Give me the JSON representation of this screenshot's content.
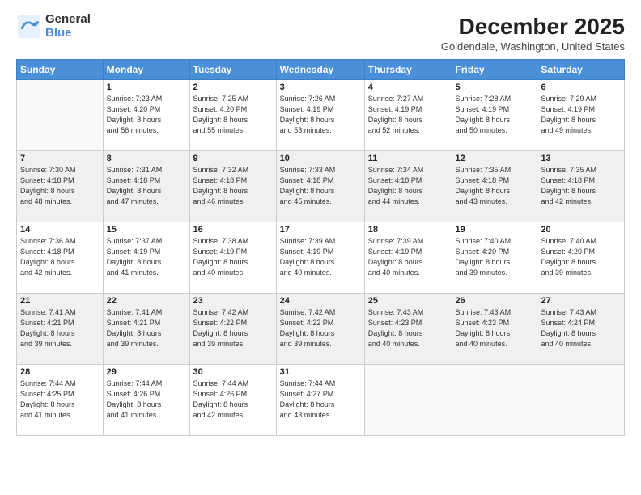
{
  "logo": {
    "line1": "General",
    "line2": "Blue"
  },
  "title": {
    "month_year": "December 2025",
    "location": "Goldendale, Washington, United States"
  },
  "days_of_week": [
    "Sunday",
    "Monday",
    "Tuesday",
    "Wednesday",
    "Thursday",
    "Friday",
    "Saturday"
  ],
  "weeks": [
    [
      {
        "num": "",
        "info": ""
      },
      {
        "num": "1",
        "info": "Sunrise: 7:23 AM\nSunset: 4:20 PM\nDaylight: 8 hours\nand 56 minutes."
      },
      {
        "num": "2",
        "info": "Sunrise: 7:25 AM\nSunset: 4:20 PM\nDaylight: 8 hours\nand 55 minutes."
      },
      {
        "num": "3",
        "info": "Sunrise: 7:26 AM\nSunset: 4:19 PM\nDaylight: 8 hours\nand 53 minutes."
      },
      {
        "num": "4",
        "info": "Sunrise: 7:27 AM\nSunset: 4:19 PM\nDaylight: 8 hours\nand 52 minutes."
      },
      {
        "num": "5",
        "info": "Sunrise: 7:28 AM\nSunset: 4:19 PM\nDaylight: 8 hours\nand 50 minutes."
      },
      {
        "num": "6",
        "info": "Sunrise: 7:29 AM\nSunset: 4:19 PM\nDaylight: 8 hours\nand 49 minutes."
      }
    ],
    [
      {
        "num": "7",
        "info": "Sunrise: 7:30 AM\nSunset: 4:18 PM\nDaylight: 8 hours\nand 48 minutes."
      },
      {
        "num": "8",
        "info": "Sunrise: 7:31 AM\nSunset: 4:18 PM\nDaylight: 8 hours\nand 47 minutes."
      },
      {
        "num": "9",
        "info": "Sunrise: 7:32 AM\nSunset: 4:18 PM\nDaylight: 8 hours\nand 46 minutes."
      },
      {
        "num": "10",
        "info": "Sunrise: 7:33 AM\nSunset: 4:18 PM\nDaylight: 8 hours\nand 45 minutes."
      },
      {
        "num": "11",
        "info": "Sunrise: 7:34 AM\nSunset: 4:18 PM\nDaylight: 8 hours\nand 44 minutes."
      },
      {
        "num": "12",
        "info": "Sunrise: 7:35 AM\nSunset: 4:18 PM\nDaylight: 8 hours\nand 43 minutes."
      },
      {
        "num": "13",
        "info": "Sunrise: 7:35 AM\nSunset: 4:18 PM\nDaylight: 8 hours\nand 42 minutes."
      }
    ],
    [
      {
        "num": "14",
        "info": "Sunrise: 7:36 AM\nSunset: 4:18 PM\nDaylight: 8 hours\nand 42 minutes."
      },
      {
        "num": "15",
        "info": "Sunrise: 7:37 AM\nSunset: 4:19 PM\nDaylight: 8 hours\nand 41 minutes."
      },
      {
        "num": "16",
        "info": "Sunrise: 7:38 AM\nSunset: 4:19 PM\nDaylight: 8 hours\nand 40 minutes."
      },
      {
        "num": "17",
        "info": "Sunrise: 7:39 AM\nSunset: 4:19 PM\nDaylight: 8 hours\nand 40 minutes."
      },
      {
        "num": "18",
        "info": "Sunrise: 7:39 AM\nSunset: 4:19 PM\nDaylight: 8 hours\nand 40 minutes."
      },
      {
        "num": "19",
        "info": "Sunrise: 7:40 AM\nSunset: 4:20 PM\nDaylight: 8 hours\nand 39 minutes."
      },
      {
        "num": "20",
        "info": "Sunrise: 7:40 AM\nSunset: 4:20 PM\nDaylight: 8 hours\nand 39 minutes."
      }
    ],
    [
      {
        "num": "21",
        "info": "Sunrise: 7:41 AM\nSunset: 4:21 PM\nDaylight: 8 hours\nand 39 minutes."
      },
      {
        "num": "22",
        "info": "Sunrise: 7:41 AM\nSunset: 4:21 PM\nDaylight: 8 hours\nand 39 minutes."
      },
      {
        "num": "23",
        "info": "Sunrise: 7:42 AM\nSunset: 4:22 PM\nDaylight: 8 hours\nand 39 minutes."
      },
      {
        "num": "24",
        "info": "Sunrise: 7:42 AM\nSunset: 4:22 PM\nDaylight: 8 hours\nand 39 minutes."
      },
      {
        "num": "25",
        "info": "Sunrise: 7:43 AM\nSunset: 4:23 PM\nDaylight: 8 hours\nand 40 minutes."
      },
      {
        "num": "26",
        "info": "Sunrise: 7:43 AM\nSunset: 4:23 PM\nDaylight: 8 hours\nand 40 minutes."
      },
      {
        "num": "27",
        "info": "Sunrise: 7:43 AM\nSunset: 4:24 PM\nDaylight: 8 hours\nand 40 minutes."
      }
    ],
    [
      {
        "num": "28",
        "info": "Sunrise: 7:44 AM\nSunset: 4:25 PM\nDaylight: 8 hours\nand 41 minutes."
      },
      {
        "num": "29",
        "info": "Sunrise: 7:44 AM\nSunset: 4:26 PM\nDaylight: 8 hours\nand 41 minutes."
      },
      {
        "num": "30",
        "info": "Sunrise: 7:44 AM\nSunset: 4:26 PM\nDaylight: 8 hours\nand 42 minutes."
      },
      {
        "num": "31",
        "info": "Sunrise: 7:44 AM\nSunset: 4:27 PM\nDaylight: 8 hours\nand 43 minutes."
      },
      {
        "num": "",
        "info": ""
      },
      {
        "num": "",
        "info": ""
      },
      {
        "num": "",
        "info": ""
      }
    ]
  ]
}
